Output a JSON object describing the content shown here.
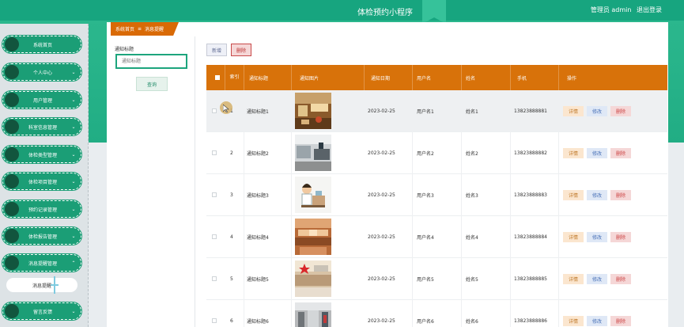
{
  "app": {
    "title": "体检预约小程序",
    "user_role": "管理员 admin",
    "logout": "退出登录"
  },
  "breadcrumb": {
    "home": "系统首页",
    "separator": "≡",
    "current": "消息提醒"
  },
  "sidebar": {
    "items": [
      {
        "label": "系统首页",
        "expandable": false
      },
      {
        "label": "个人中心",
        "expandable": true
      },
      {
        "label": "用户管理",
        "expandable": true
      },
      {
        "label": "科室信息管理",
        "expandable": true
      },
      {
        "label": "体检类型管理",
        "expandable": true
      },
      {
        "label": "体检项目管理",
        "expandable": true
      },
      {
        "label": "预约记录管理",
        "expandable": true
      },
      {
        "label": "体检报告管理",
        "expandable": true
      },
      {
        "label": "消息提醒管理",
        "expandable": true,
        "expanded": true
      },
      {
        "label": "留言反馈",
        "expandable": true
      }
    ],
    "submenu_label": "消息提醒"
  },
  "search": {
    "label": "通知标题",
    "placeholder": "通知标题",
    "button": "查询"
  },
  "toolbar": {
    "add": "新增",
    "delete": "删除"
  },
  "table": {
    "headers": [
      "",
      "索引",
      "通知标题",
      "通知图片",
      "通知日期",
      "用户名",
      "姓名",
      "手机",
      "操作"
    ],
    "actions": {
      "detail": "详情",
      "edit": "修改",
      "remove": "删除"
    },
    "rows": [
      {
        "index": "1",
        "title": "通知标题1",
        "image": "restaurant-photo",
        "date": "2023-02-25",
        "username": "用户名1",
        "name": "姓名1",
        "phone": "13823888881"
      },
      {
        "index": "2",
        "title": "通知标题2",
        "image": "reception-photo",
        "date": "2023-02-25",
        "username": "用户名2",
        "name": "姓名2",
        "phone": "13823888882"
      },
      {
        "index": "3",
        "title": "通知标题3",
        "image": "doctor-illustration",
        "date": "2023-02-25",
        "username": "用户名3",
        "name": "姓名3",
        "phone": "13823888883"
      },
      {
        "index": "4",
        "title": "通知标题4",
        "image": "lobby-photo",
        "date": "2023-02-25",
        "username": "用户名4",
        "name": "姓名4",
        "phone": "13823888884"
      },
      {
        "index": "5",
        "title": "通知标题5",
        "image": "hall-photo",
        "date": "2023-02-25",
        "username": "用户名5",
        "name": "姓名5",
        "phone": "13823888885"
      },
      {
        "index": "6",
        "title": "通知标题6",
        "image": "corridor-photo",
        "date": "2023-02-25",
        "username": "用户名6",
        "name": "姓名6",
        "phone": "13823888886"
      }
    ]
  },
  "colors": {
    "brand_green": "#17a57f",
    "header_orange": "#d8720a",
    "sidebar_pill": "#1b9e76"
  }
}
